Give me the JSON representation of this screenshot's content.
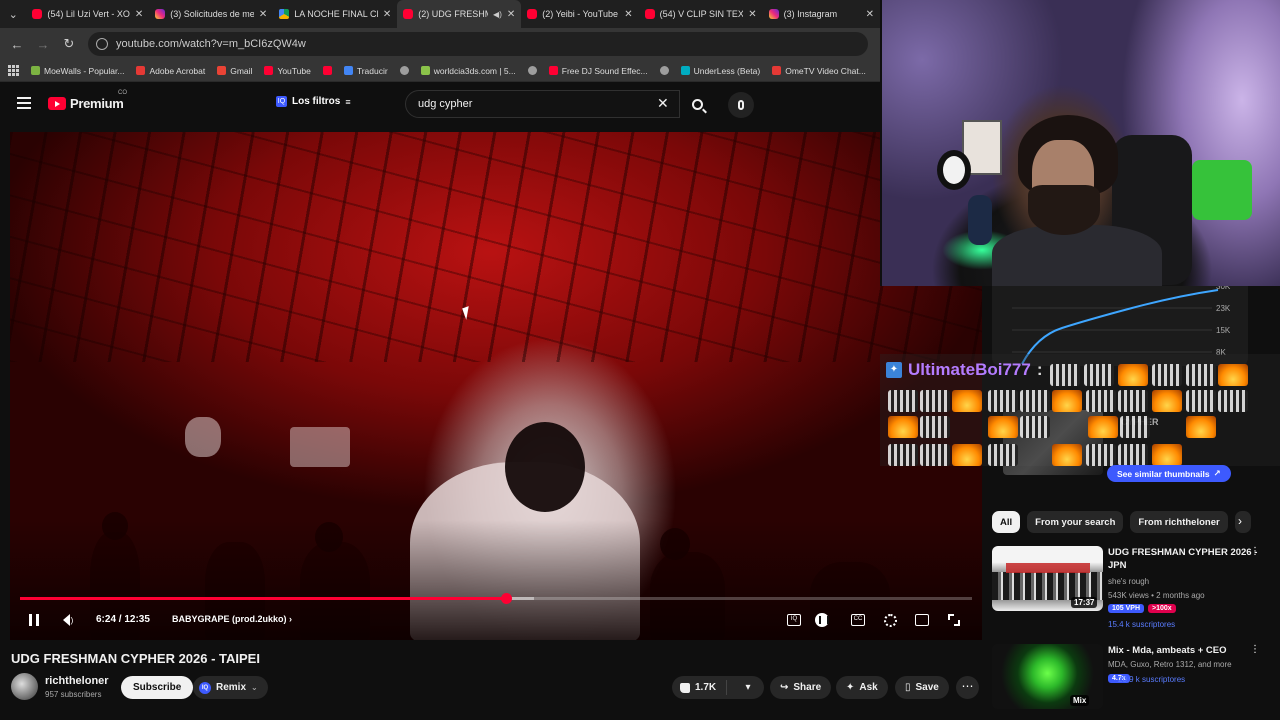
{
  "browser": {
    "tabs": [
      {
        "label": "(54) Lil Uzi Vert - XO",
        "icon": "youtube-icon",
        "active": false
      },
      {
        "label": "(3) Solicitudes de me",
        "icon": "instagram-icon",
        "active": false
      },
      {
        "label": "LA NOCHE FINAL CR",
        "icon": "drive-icon",
        "active": false
      },
      {
        "label": "(2) UDG FRESHM",
        "icon": "youtube-icon",
        "active": true
      },
      {
        "label": "(2) Yeibi - YouTube",
        "icon": "youtube-icon",
        "active": false
      },
      {
        "label": "(54) V CLIP SIN TEXT",
        "icon": "youtube-icon",
        "active": false
      },
      {
        "label": "(3) Instagram",
        "icon": "instagram-icon",
        "active": false
      }
    ],
    "url": "youtube.com/watch?v=m_bCI6zQW4w",
    "bookmarks": [
      {
        "label": "MoeWalls - Popular...",
        "color": "#7cb342"
      },
      {
        "label": "Adobe Acrobat",
        "color": "#e53935"
      },
      {
        "label": "Gmail",
        "color": "#ea4335"
      },
      {
        "label": "YouTube",
        "color": "#ff0033"
      },
      {
        "label": "",
        "color": "#ff0033"
      },
      {
        "label": "Traducir",
        "color": "#4285f4"
      },
      {
        "label": "",
        "color": "#9e9e9e"
      },
      {
        "label": "worldcia3ds.com | 5...",
        "color": "#8bc34a"
      },
      {
        "label": "",
        "color": "#9e9e9e"
      },
      {
        "label": "Free DJ Sound Effec...",
        "color": "#ff0033"
      },
      {
        "label": "",
        "color": "#9e9e9e"
      },
      {
        "label": "UnderLess (Beta)",
        "color": "#00acc1"
      },
      {
        "label": "OmeTV Video Chat...",
        "color": "#e53935"
      }
    ]
  },
  "youtube": {
    "logo_text": "Premium",
    "region": "CO",
    "filters_label": "Los filtros",
    "search_value": "udg cypher"
  },
  "player": {
    "time": "6:24 / 12:35",
    "chapter": "BABYGRAPE (prod.2ukko)",
    "progress_played": 0.51,
    "progress_buffered": 0.54
  },
  "video": {
    "title": "UDG FRESHMAN CYPHER 2026 - TAIPEI",
    "channel": "richtheloner",
    "subscribers": "957 subscribers",
    "subscribe_label": "Subscribe",
    "remix_label": "Remix",
    "likes": "1.7K",
    "share_label": "Share",
    "ask_label": "Ask",
    "save_label": "Save"
  },
  "graph_ticks": [
    "30K",
    "23K",
    "15K",
    "8K"
  ],
  "chat": {
    "username": "UltimateBoi777",
    "colon": ":",
    "similar_label": "See similar thumbnails",
    "ghost_title": "N CYPHER"
  },
  "chips": [
    "All",
    "From your search",
    "From richtheloner"
  ],
  "recommendations": [
    {
      "title": "UDG FRESHMAN CYPHER 2026 - JPN",
      "channel": "she's rough",
      "meta": "543K views • 2 months ago",
      "duration": "17:37",
      "vph": "105 VPH",
      "mult": ">100x",
      "subs": "15.4 k suscriptores"
    },
    {
      "title": "Mix - Mda, ambeats + CEO",
      "channel": "MDA, Guxo, Retro 1312, and more",
      "badge": "4.7x",
      "subs": "20.9 k suscriptores",
      "duration": "Mix"
    }
  ]
}
